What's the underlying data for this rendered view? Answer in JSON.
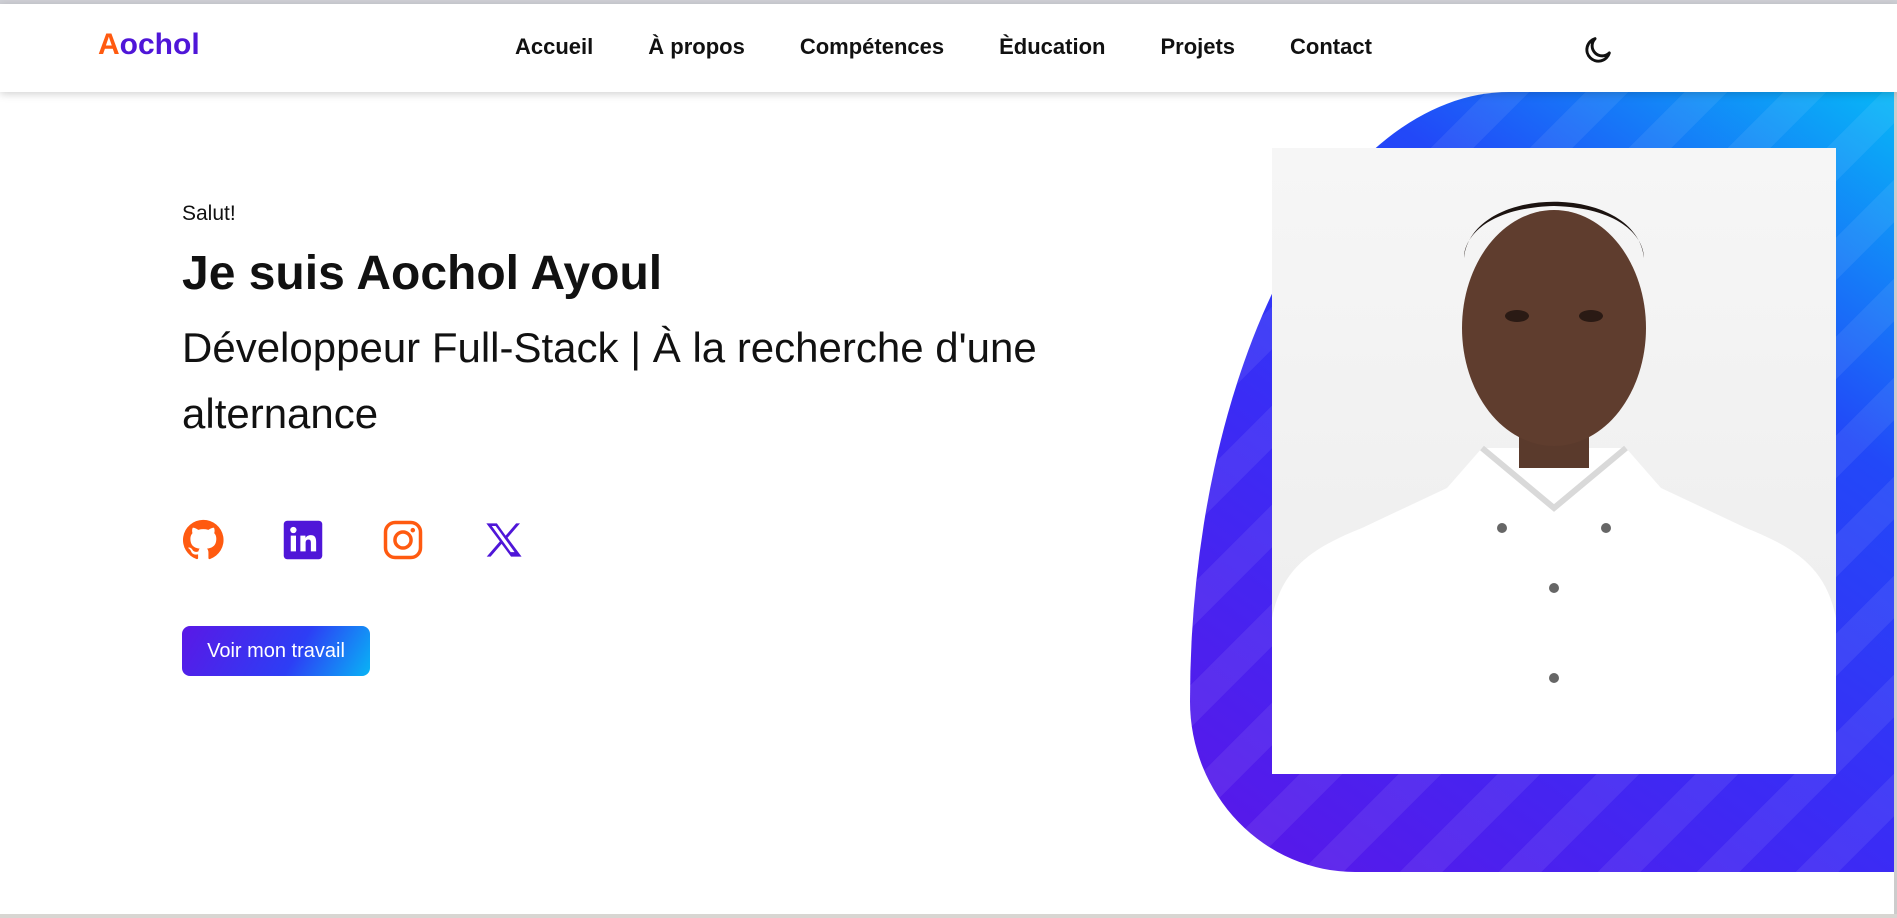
{
  "navbar": {
    "logo_first": "A",
    "logo_rest": "ochol",
    "links": [
      "Accueil",
      "À propos",
      "Compétences",
      "Èducation",
      "Projets",
      "Contact"
    ],
    "theme_toggle_icon": "moon-icon"
  },
  "hero": {
    "greeting": "Salut!",
    "title": "Je suis Aochol Ayoul",
    "subtitle": "Développeur Full-Stack | À la recherche d'une alternance",
    "socials": [
      {
        "icon": "github-icon",
        "color": "#ff5a10"
      },
      {
        "icon": "linkedin-icon",
        "color": "#4f16d8"
      },
      {
        "icon": "instagram-icon",
        "color": "#ff5a10"
      },
      {
        "icon": "x-icon",
        "color": "#4f16d8"
      }
    ],
    "cta_label": "Voir mon travail",
    "photo": "profile-photo"
  },
  "colors": {
    "accent_orange": "#ff5a10",
    "accent_purple": "#4f16d8",
    "gradient_blue": "#2248f8",
    "gradient_cyan": "#07b8f7"
  }
}
